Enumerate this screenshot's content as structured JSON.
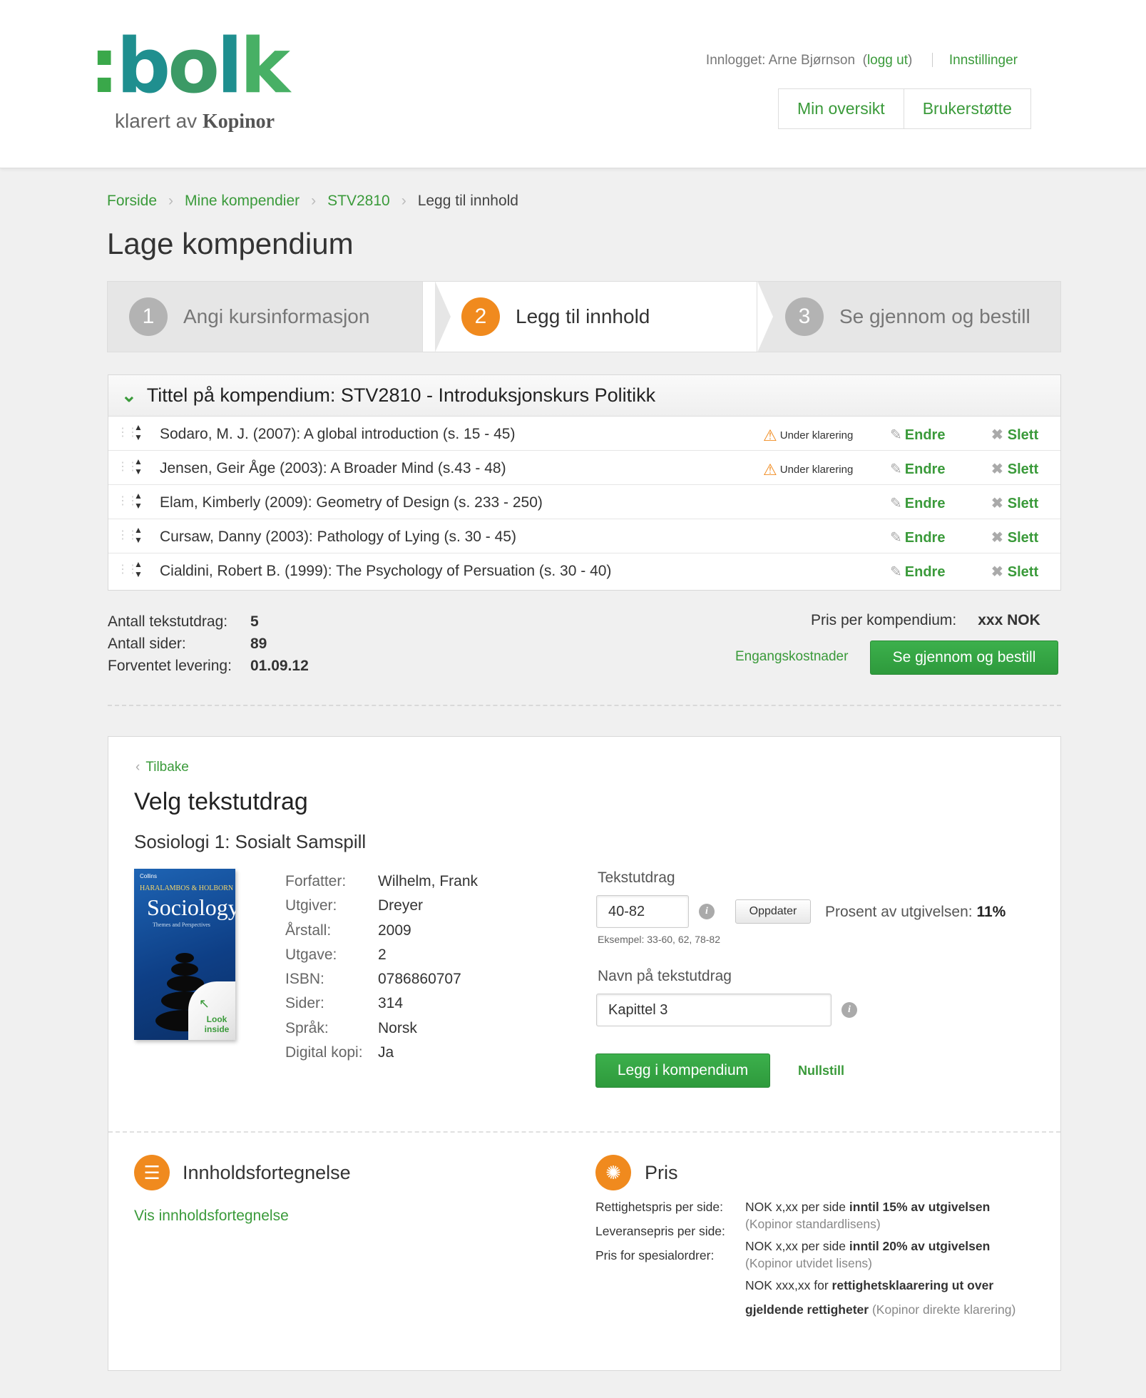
{
  "header": {
    "logo_text": ":bolk",
    "logo_sub": "klarert av",
    "logo_brand": "Kopinor",
    "logged_in_label": "Innlogget: Arne Bjørnson",
    "logout": "logg ut",
    "settings": "Innstillinger",
    "nav": [
      "Min oversikt",
      "Brukerstøtte"
    ]
  },
  "breadcrumb": [
    "Forside",
    "Mine kompendier",
    "STV2810",
    "Legg til innhold"
  ],
  "page_title": "Lage kompendium",
  "steps": [
    {
      "num": "1",
      "label": "Angi kursinformasjon",
      "state": "done"
    },
    {
      "num": "2",
      "label": "Legg til innhold",
      "state": "active"
    },
    {
      "num": "3",
      "label": "Se gjennom og bestill",
      "state": "todo"
    }
  ],
  "compendium": {
    "title": "Tittel på kompendium: STV2810 - Introduksjonskurs Politikk",
    "edit_label": "Endre",
    "delete_label": "Slett",
    "warn_label": "Under klarering",
    "items": [
      {
        "text": "Sodaro, M. J. (2007): A global introduction (s. 15 - 45)",
        "warning": true
      },
      {
        "text": "Jensen, Geir Åge (2003): A Broader Mind (s.43 - 48)",
        "warning": true
      },
      {
        "text": "Elam, Kimberly (2009): Geometry of Design (s. 233 - 250)",
        "warning": false
      },
      {
        "text": "Cursaw, Danny (2003): Pathology of Lying (s. 30 - 45)",
        "warning": false
      },
      {
        "text": "Cialdini, Robert B. (1999): The Psychology of Persuation (s. 30 - 40)",
        "warning": false
      }
    ]
  },
  "summary": {
    "count_label": "Antall tekstutdrag:",
    "count": "5",
    "pages_label": "Antall sider:",
    "pages": "89",
    "delivery_label": "Forventet levering:",
    "delivery": "01.09.12",
    "price_label": "Pris per kompendium:",
    "price": "xxx NOK",
    "oneoff_link": "Engangskostnader",
    "review_button": "Se gjennom og bestill"
  },
  "detail": {
    "back": "Tilbake",
    "heading": "Velg tekstutdrag",
    "book_title": "Sosiologi 1: Sosialt Samspill",
    "cover": {
      "publisher": "Collins",
      "authors": "HARALAMBOS & HOLBORN",
      "title": "Sociology",
      "subtitle": "Themes and Perspectives",
      "look": "Look inside"
    },
    "meta": [
      {
        "k": "Forfatter:",
        "v": "Wilhelm, Frank"
      },
      {
        "k": "Utgiver:",
        "v": "Dreyer"
      },
      {
        "k": "Årstall:",
        "v": "2009"
      },
      {
        "k": "Utgave:",
        "v": "2"
      },
      {
        "k": "ISBN:",
        "v": "0786860707"
      },
      {
        "k": "Sider:",
        "v": "314"
      },
      {
        "k": "Språk:",
        "v": "Norsk"
      },
      {
        "k": "Digital kopi:",
        "v": "Ja"
      }
    ],
    "excerpt_label": "Tekstutdrag",
    "excerpt_value": "40-82",
    "update_button": "Oppdater",
    "percent_label": "Prosent av utgivelsen:",
    "percent_value": "11%",
    "example": "Eksempel: 33-60, 62, 78-82",
    "name_label": "Navn på tekstutdrag",
    "name_value": "Kapittel 3",
    "add_button": "Legg i kompendium",
    "reset": "Nullstill"
  },
  "toc": {
    "title": "Innholdsfortegnelse",
    "link": "Vis innholdsfortegnelse"
  },
  "price": {
    "title": "Pris",
    "labels": [
      "Rettighetspris per side:",
      "Leveransepris per side:",
      "Pris for spesialordrer:"
    ],
    "l1a": "NOK x,xx per side ",
    "l1b": "inntil 15% av utgivelsen",
    "l2": "(Kopinor standardlisens)",
    "l3a": "NOK x,xx per side ",
    "l3b": "inntil 20% av utgivelsen",
    "l4": "(Kopinor utvidet lisens)",
    "l5a": "NOK xxx,xx for ",
    "l5b": "rettighetsklaarering ut over",
    "l6a": "gjeldende rettigheter",
    "l6b": " (Kopinor direkte klarering)"
  }
}
